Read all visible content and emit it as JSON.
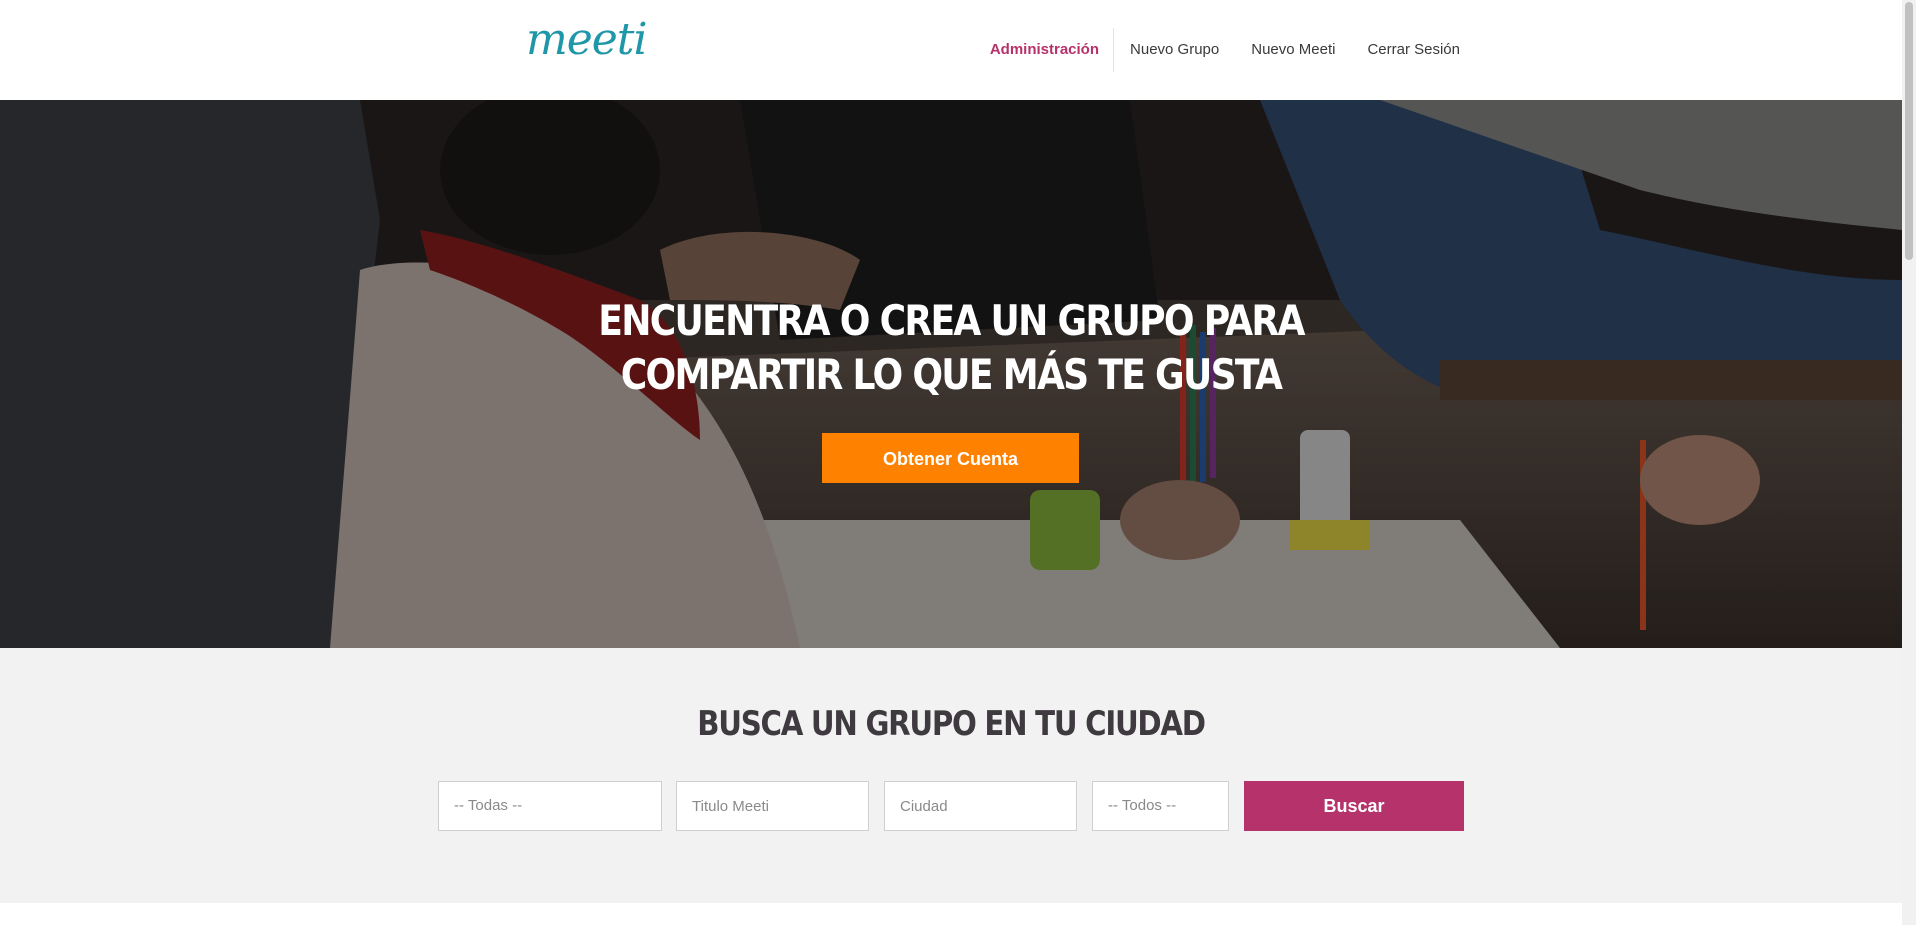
{
  "header": {
    "logo": "meeti",
    "nav": [
      {
        "label": "Administración",
        "active": true
      },
      {
        "label": "Nuevo Grupo",
        "active": false
      },
      {
        "label": "Nuevo Meeti",
        "active": false
      },
      {
        "label": "Cerrar Sesión",
        "active": false
      }
    ]
  },
  "hero": {
    "title_line1": "Encuentra o crea un grupo para",
    "title_line2": "compartir lo que más te gusta",
    "cta_label": "Obtener Cuenta"
  },
  "search": {
    "title": "Busca un grupo en tu ciudad",
    "category_value": "-- Todas --",
    "title_placeholder": "Titulo Meeti",
    "city_placeholder": "Ciudad",
    "country_value": "-- Todos --",
    "button_label": "Buscar"
  },
  "colors": {
    "brand": "#1f97a8",
    "accent": "#b5326a",
    "cta": "#ff8100"
  }
}
